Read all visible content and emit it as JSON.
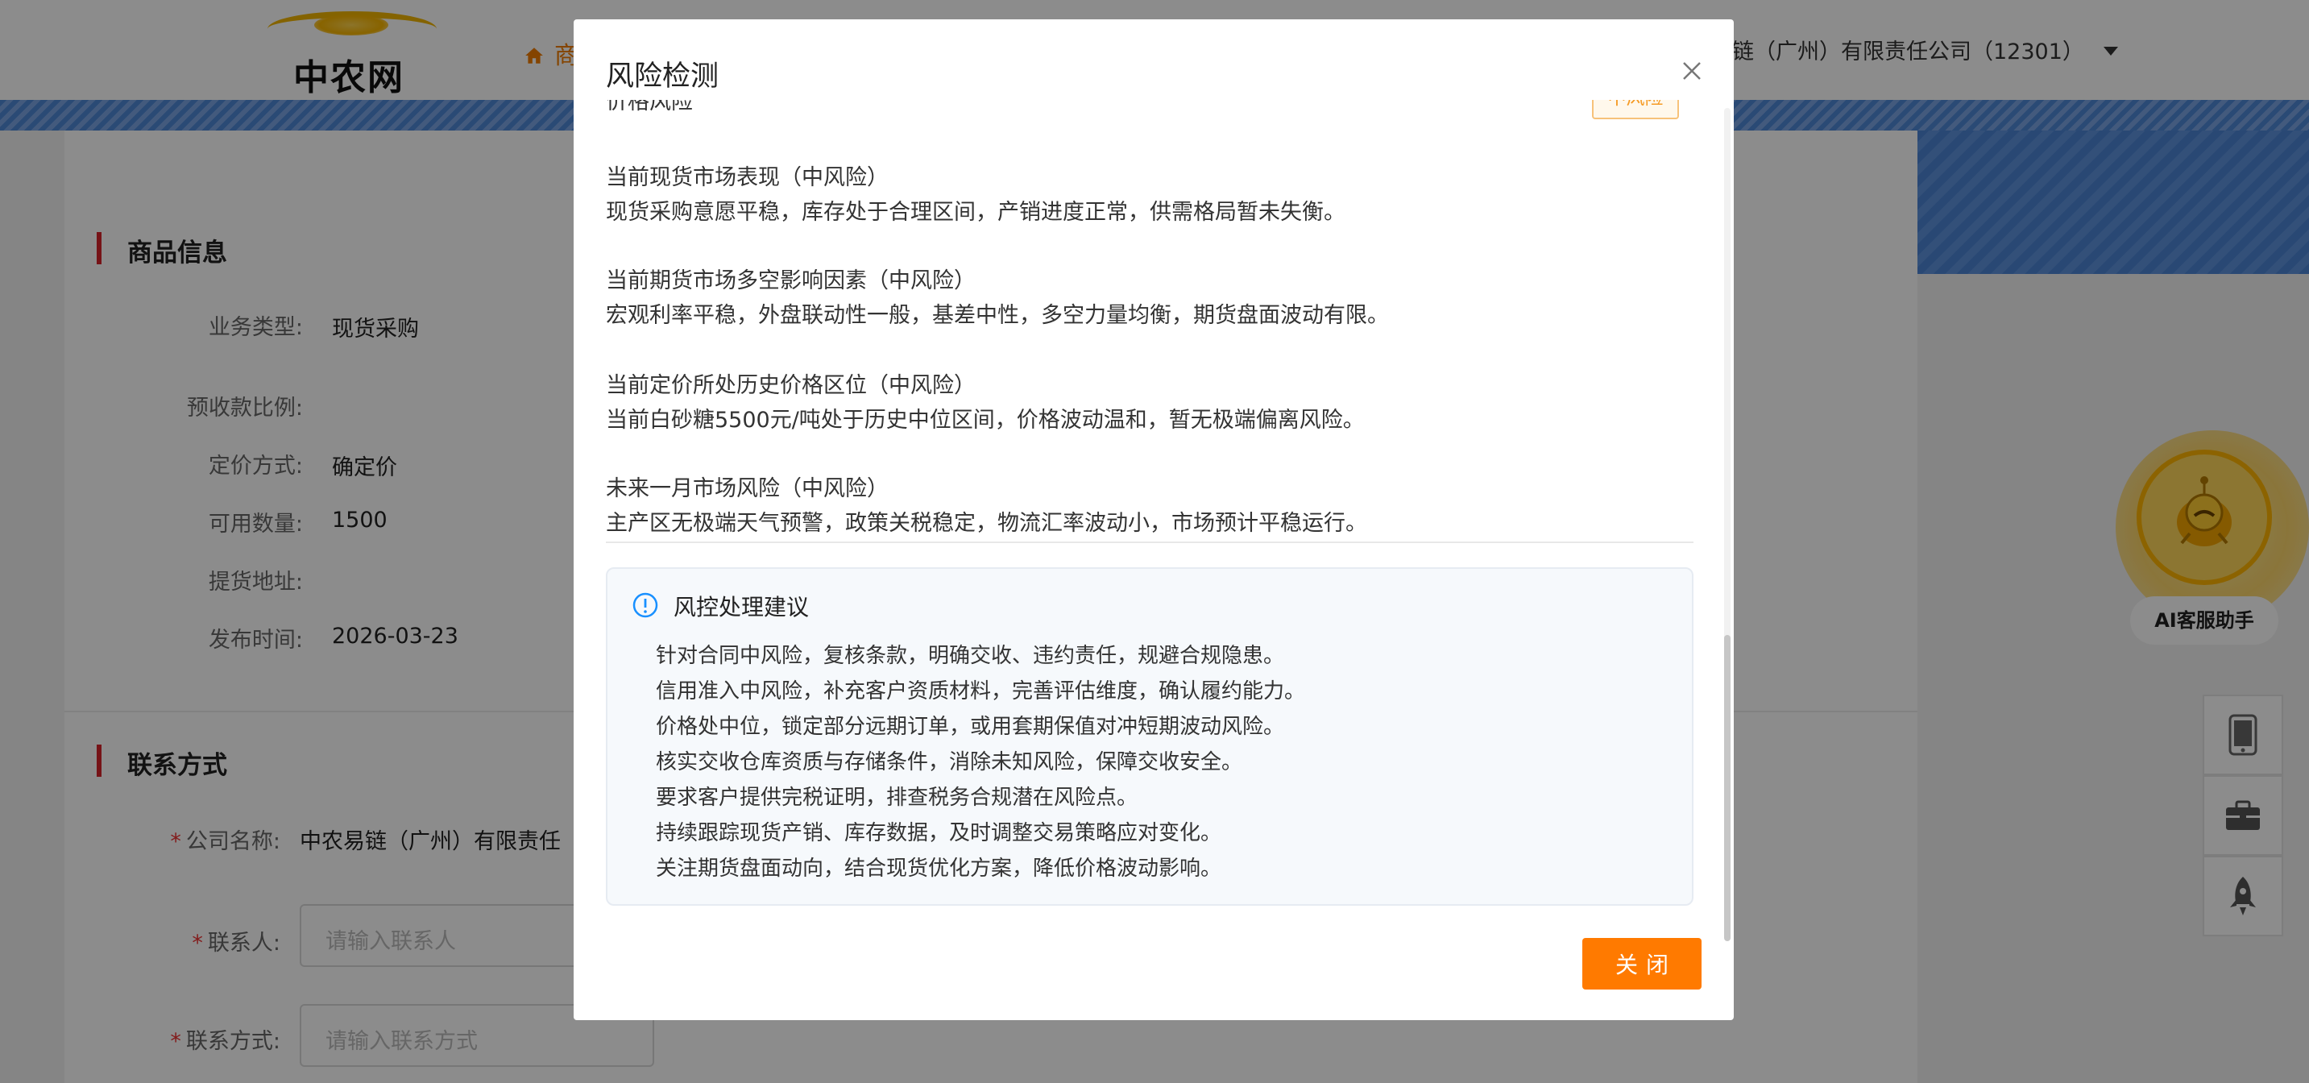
{
  "header": {
    "logo_text": "中农网",
    "nav_home": "商",
    "company_account": "链（广州）有限责任公司（12301）"
  },
  "product_section": {
    "title": "商品信息",
    "fields": [
      {
        "label": "业务类型:",
        "value": "现货采购"
      },
      {
        "label": "预收款比例:",
        "value": ""
      },
      {
        "label": "定价方式:",
        "value": "确定价"
      },
      {
        "label": "可用数量:",
        "value": "1500"
      },
      {
        "label": "提货地址:",
        "value": ""
      },
      {
        "label": "发布时间:",
        "value": "2026-03-23"
      }
    ]
  },
  "contact_section": {
    "title": "联系方式",
    "company_label": "公司名称:",
    "company_value": "中农易链（广州）有限责任",
    "contact_label": "联系人:",
    "contact_placeholder": "请输入联系人",
    "phone_label": "联系方式:",
    "phone_placeholder": "请输入联系方式"
  },
  "side_tools": {
    "ai_label": "AI客服助手",
    "icons": [
      "mobile-icon",
      "briefcase-icon",
      "rocket-icon"
    ]
  },
  "modal": {
    "title": "风险检测",
    "cut_row_label": "价格风险",
    "cut_row_badge": "中风险",
    "risk_items": [
      {
        "head": "当前现货市场表现（中风险）",
        "desc": "现货采购意愿平稳，库存处于合理区间，产销进度正常，供需格局暂未失衡。"
      },
      {
        "head": "当前期货市场多空影响因素（中风险）",
        "desc": "宏观利率平稳，外盘联动性一般，基差中性，多空力量均衡，期货盘面波动有限。"
      },
      {
        "head": "当前定价所处历史价格区位（中风险）",
        "desc": "当前白砂糖5500元/吨处于历史中位区间，价格波动温和，暂无极端偏离风险。"
      },
      {
        "head": "未来一月市场风险（中风险）",
        "desc": "主产区无极端天气预警，政策关税稳定，物流汇率波动小，市场预计平稳运行。"
      }
    ],
    "advice": {
      "title": "风控处理建议",
      "items": [
        "针对合同中风险，复核条款，明确交收、违约责任，规避合规隐患。",
        "信用准入中风险，补充客户资质材料，完善评估维度，确认履约能力。",
        "价格处中位，锁定部分远期订单，或用套期保值对冲短期波动风险。",
        "核实交收仓库资质与存储条件，消除未知风险，保障交收安全。",
        "要求客户提供完税证明，排查税务合规潜在风险点。",
        "持续跟踪现货产销、库存数据，及时调整交易策略应对变化。",
        "关注期货盘面动向，结合现货优化方案，降低价格波动影响。"
      ]
    },
    "close_button": "关闭"
  },
  "colors": {
    "accent_orange": "#ff7a00",
    "brand_red": "#d8242b",
    "banner_blue": "#4e87d6",
    "badge_orange": "#f59a23",
    "info_blue": "#1890ff"
  }
}
